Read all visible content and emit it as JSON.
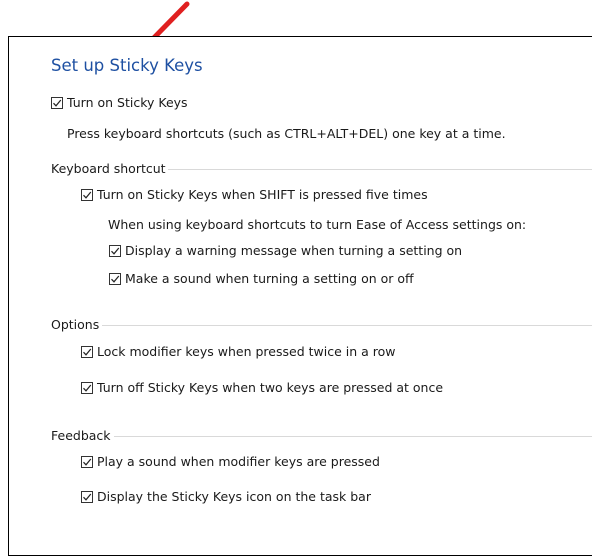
{
  "colors": {
    "title": "#1e50a2",
    "annotation_arrow": "#e02020"
  },
  "title": "Set up Sticky Keys",
  "turn_on": {
    "label": "Turn on Sticky Keys",
    "checked": true,
    "description": "Press keyboard shortcuts (such as CTRL+ALT+DEL) one key at a time."
  },
  "keyboard_shortcut": {
    "heading": "Keyboard shortcut",
    "shift_five": {
      "label": "Turn on Sticky Keys when SHIFT is pressed five times",
      "checked": true
    },
    "info": "When using keyboard shortcuts to turn Ease of Access settings on:",
    "warning": {
      "label": "Display a warning message when turning a setting on",
      "checked": true
    },
    "sound": {
      "label": "Make a sound when turning a setting on or off",
      "checked": true
    }
  },
  "options": {
    "heading": "Options",
    "lock": {
      "label": "Lock modifier keys when pressed twice in a row",
      "checked": true
    },
    "turn_off": {
      "label": "Turn off Sticky Keys when two keys are pressed at once",
      "checked": true
    }
  },
  "feedback": {
    "heading": "Feedback",
    "play_sound": {
      "label": "Play a sound when modifier keys are pressed",
      "checked": true
    },
    "taskbar_icon": {
      "label": "Display the Sticky Keys icon on the task bar",
      "checked": true
    }
  }
}
